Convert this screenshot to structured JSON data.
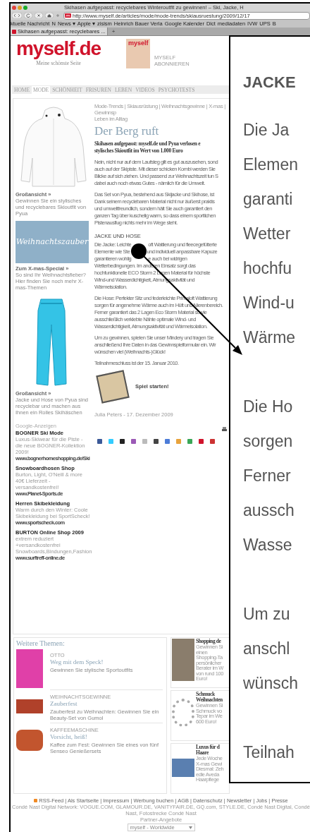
{
  "browser": {
    "title": "Skihasen aufgepasst: recyclebares Winteroutfit zu gewinnen! – Ski, Jacke, H",
    "url": "http://www.myself.de/articles/mode/mode-trends/skiausruestung/2009/12/17",
    "bookmarks": [
      "ktuelle Nachricht",
      "N",
      "News ▾",
      "Apple ▾",
      "zisism",
      "Heinrich Bauer Verla",
      "Google Kalender",
      "Dict",
      "mediadaten",
      "IVW",
      "UPS",
      "B"
    ],
    "tabs": [
      {
        "label": "Skihasen aufgepasst: recyclebares ...",
        "selected": true
      }
    ],
    "new_tab": "+"
  },
  "site": {
    "logo": "myself.de",
    "tagline": "Meine schönste Seite",
    "cover_logo": "myself",
    "subscribe": "MYSELF ABONNIEREN",
    "nav": [
      {
        "label": "HOME",
        "selected": false
      },
      {
        "label": "MODE",
        "selected": true
      },
      {
        "label": "SCHÖNHEIT",
        "selected": false
      },
      {
        "label": "FRISUREN",
        "selected": false
      },
      {
        "label": "LEBEN",
        "selected": false
      },
      {
        "label": "VIDEOS",
        "selected": false
      },
      {
        "label": "PSYCHOTESTS",
        "selected": false
      }
    ],
    "sidebar": {
      "figures": [
        {
          "kind": "jacket",
          "link": "Großansicht »",
          "caption": "Gewinnen Sie ein stylisches und recyclebares Skioutfit von Pyua"
        },
        {
          "kind": "banner",
          "banner_text": "Weihnachtszauber",
          "link": "Zum X-mas-Special »",
          "caption": "So sind Ihr Weihnachtsfieber? Hier finden Sie noch mehr X-mas-Themen"
        },
        {
          "kind": "pants",
          "link": "Großansicht »",
          "caption": "Jacke und Hose von Pyua sind recyclebar und machen aus Ihnen ein Rolles Skihäschen"
        }
      ],
      "ads_label": "Google-Anzeigen",
      "ads": [
        {
          "title": "BOGNER Ski Mode",
          "text": "Luxus-Skiwear für die Piste - die neue BOGNER-Kollektion 2009!",
          "url": "www.bognerhomeshopping.de/Ski"
        },
        {
          "title": "Snowboardhosen Shop",
          "text": "Burton, Light, O'Neill & more 40€ Lieferzeit - versandkostenfrei!",
          "url": "www.Planet-Sports.de"
        },
        {
          "title": "Herren Skibekleidung",
          "text": "Warm durch den Winter: Coole Skibekleidung bei SportScheck!",
          "url": "www.sportscheck.com"
        },
        {
          "title": "BURTON Online Shop 2009",
          "text": "extrem reduziert +versandkostenfrei Snowboards,Bindungen,Fashion",
          "url": "www.surftreff-online.de"
        }
      ]
    },
    "article": {
      "breadcrumb": [
        "Mode-Trends | Skiausrüstung | Weihnachtsgewinne | X-mas | Gewinnsp",
        "Leben im Alltag"
      ],
      "title": "Der Berg ruft",
      "subtitle": [
        "Skihasen aufgepasst: myself.de und Pyua verlosen e",
        "stylisches Skioutfit im Wert von 1.000 Euro"
      ],
      "intro": [
        [
          "Nein, nicht nur auf dem Laufsteg gilt es gut auszusehen, sond",
          "auch auf der Skipiste. Mit dieser schicken Kombi werden Sie",
          "Blicke auf sich ziehen. Und passend zur Weihnachtszeit tun S",
          "dabei auch noch etwas Gutes - nämlich für die Umwelt."
        ],
        [
          "Das Set von Pyua, bestehend aus Skijacke und Skihose, ist",
          "Dank seinem recyclebaren Material nicht nur äußerst praktis",
          "und umweltfreundlich, sondern hält Sie auch garantiert den",
          "ganzen Tag über kuschelig warm, so dass einem sportlichen",
          "Pistenausflug nichts mehr im Wege steht."
        ]
      ],
      "section_heading": "JACKE UND HOSE",
      "body": [
        [
          [
            "Die Jacke: Leichte",
            "oft Wattierung und fleecegefütterte"
          ],
          [
            "Elemente wie Ste",
            "und individuell anpassbare Kapuze"
          ],
          [
            "garantieren wohlig",
            "e auch bei widrigen"
          ],
          "Wetterbedingungen. Im anderen Einsatz sorgt das",
          "hochfunktionelle ECO Storm 2 Lagen Material für höchste",
          "Wind-und Wasserdichtigkeit, Atmungsaktivität und",
          "Wärmeisolation."
        ],
        [
          "Die Hose: Perfekter Sitz und federleichte Primaloft Wattierung",
          "sorgen für angenehme Wärme auch im Hüft und Nierenbereich.",
          "Ferner garantiert das 2 Lagen Eco Storm Material sowie",
          "ausschließlich verklebte Nähte optimale Wind- und",
          "Wasserdichtigkeit, Atmungsaktivität und Wärmeisolation."
        ],
        [
          "Um zu gewinnen, spielen Sie unser Mindery und tragen Sie",
          "anschließend Ihre Daten in das Gewinnspielformular ein. Wir",
          "wünschen viel (Weihnachts-)Glück!"
        ],
        [
          "Teilnahmeschluss ist der 15. Januar 2010."
        ]
      ],
      "game_button": "Spiel starten!",
      "byline": "Julia Peters - 17. Dezember 2009"
    },
    "more_topics": {
      "heading": "Weitere Themen:",
      "items": [
        {
          "kind": "person",
          "kicker": "OTTO",
          "title": "Weg mit dem Speck!",
          "text": "Gewinnen Sie stylische Sportoutfits"
        },
        {
          "kind": "lipsticks",
          "kicker": "WEIHNACHTSGEWINNE",
          "title": "Zauberfest",
          "text": "Zauberfest zu Weihnachten: Gewinnen Sie ein Beauty-Set von Gumol"
        },
        {
          "kind": "coffee",
          "kicker": "KAFFEEMASCHINE",
          "title": "Vorsicht, heiß!",
          "text": "Kaffee zum Fest: Gewinnen Sie eines von fünf Senseo Genießersets"
        }
      ]
    },
    "side_cards": [
      {
        "kind": "street",
        "title": [
          "Shopping de"
        ],
        "text": [
          "Gewinnen Si",
          "einen",
          "Shopping-Ta",
          "persönlicher",
          "Berater im W",
          "von rund 100",
          "Euro!"
        ]
      },
      {
        "kind": "necklace",
        "title": [
          "Schmuck",
          "Weihnachten"
        ],
        "text": [
          "Gewinnen Si",
          "Schmuck vo",
          "Tepar im We",
          "600 Euro!"
        ]
      },
      {
        "kind": "haircare",
        "title": [
          "Luxus für d",
          "Haare"
        ],
        "text": [
          "Jede Woche",
          "X-mas Gewi",
          "Diesmal: Zeh",
          "edle Aveda",
          "Haarpflege"
        ]
      }
    ]
  },
  "footer": {
    "links": "RSS-Feed | Als Startseite | Impressum | Werbung buchen | AGB | Datenschutz | Newsletter | Jobs | Presse",
    "network": "Condé Nast Digital Network: VOGUE.COM, GLAMOUR.DE, VANITYFAIR.DE, GQ.com, STYLE.DE, Condé Nast Digital, Condé Nast, Fotostrecke Condé Nast",
    "partner_label": "Partner-Angebote",
    "select": "myself - Worldwide"
  },
  "callout": {
    "heading": "JACKE",
    "paragraphs": [
      [
        "Die Ja",
        "Elemen",
        "garanti",
        "Wetter",
        "hochfu",
        "Wind-u",
        "Wärme"
      ],
      [
        "Die Ho",
        "sorgen",
        "Ferner",
        "aussch",
        "Wasse"
      ],
      [
        "Um zu",
        "anschl",
        "wünsch"
      ],
      [
        "Teilnah"
      ]
    ]
  }
}
